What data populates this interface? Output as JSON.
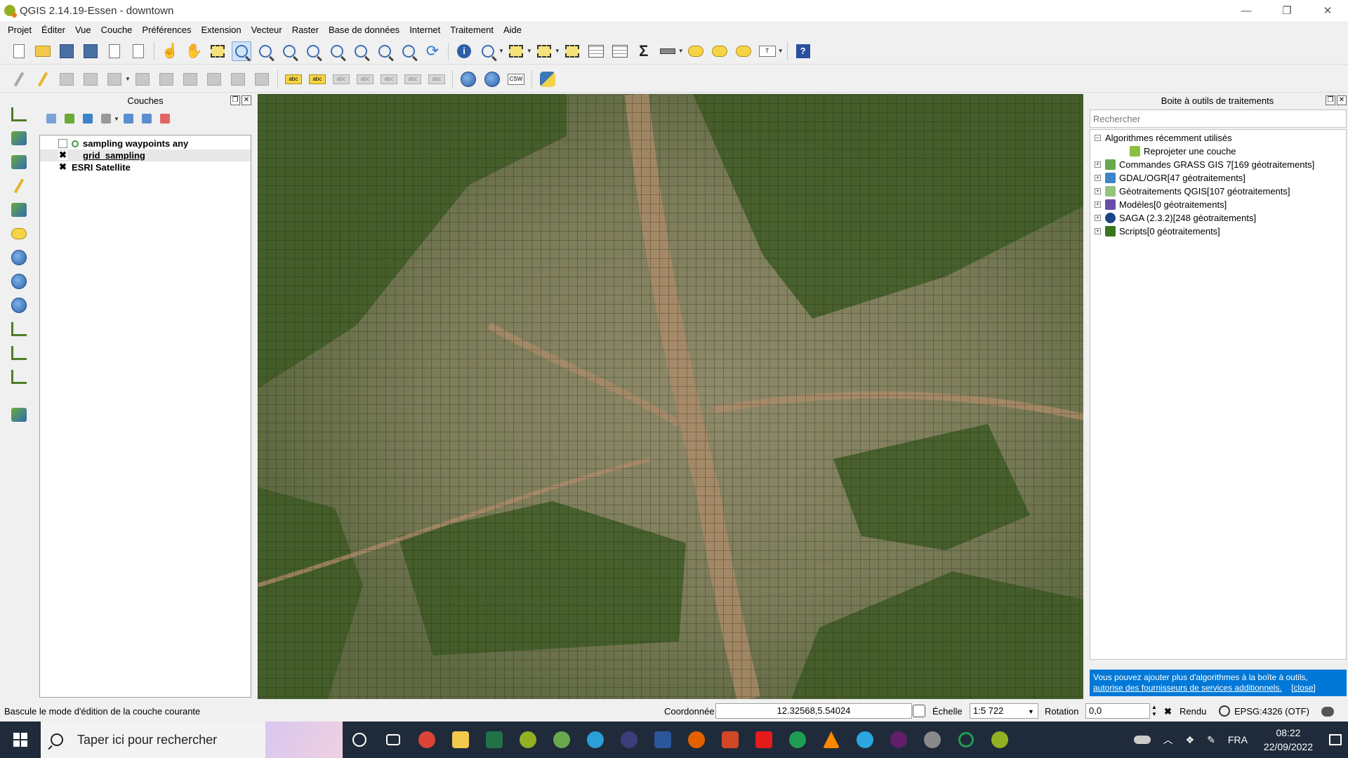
{
  "window": {
    "title": "QGIS 2.14.19-Essen - downtown",
    "minimize": "—",
    "maximize": "❐",
    "close": "✕"
  },
  "menu": [
    "Projet",
    "Éditer",
    "Vue",
    "Couche",
    "Préférences",
    "Extension",
    "Vecteur",
    "Raster",
    "Base de données",
    "Internet",
    "Traitement",
    "Aide"
  ],
  "layers_panel": {
    "title": "Couches",
    "layers": [
      {
        "name": "sampling waypoints any",
        "checked": false
      },
      {
        "name": "grid_sampling",
        "checked": true,
        "check_mark": "✖"
      },
      {
        "name": "ESRI Satellite",
        "checked": true,
        "check_mark": "✖"
      }
    ]
  },
  "toolbox": {
    "title": "Boite à outils de traitements",
    "search_placeholder": "Rechercher",
    "tree": [
      {
        "label": "Algorithmes récemment utilisés",
        "toggle": "−",
        "icon_color": ""
      },
      {
        "label": "Reprojeter une couche",
        "toggle": "",
        "icon_color": "#8bbf3f",
        "child": true
      },
      {
        "label": "Commandes GRASS GIS 7[169 géotraitements]",
        "toggle": "+",
        "icon_color": "#6aa84f"
      },
      {
        "label": "GDAL/OGR[47 géotraitements]",
        "toggle": "+",
        "icon_color": "#3d85c6"
      },
      {
        "label": "Géotraitements QGIS[107 géotraitements]",
        "toggle": "+",
        "icon_color": "#93c47d"
      },
      {
        "label": "Modèles[0 géotraitements]",
        "toggle": "+",
        "icon_color": "#674ea7"
      },
      {
        "label": "SAGA (2.3.2)[248 géotraitements]",
        "toggle": "+",
        "icon_color": "#1c4587"
      },
      {
        "label": "Scripts[0 géotraitements]",
        "toggle": "+",
        "icon_color": "#38761d"
      }
    ],
    "notice_text": "Vous pouvez ajouter plus d'algorithmes à la boîte à outils,",
    "notice_link": "autorise des fournisseurs de services additionnels.",
    "notice_close": "[close]"
  },
  "statusbar": {
    "message": "Bascule le mode d'édition de la couche courante",
    "coord_label": "Coordonnée",
    "coord_value": "12.32568,5.54024",
    "scale_label": "Échelle",
    "scale_value": "1:5 722",
    "rotation_label": "Rotation",
    "rotation_value": "0,0",
    "render_label": "Rendu",
    "render_check": "✖",
    "crs": "EPSG:4326 (OTF)"
  },
  "taskbar": {
    "search_text": "Taper ici pour rechercher",
    "apps": [
      {
        "name": "cortana",
        "color": "#ffffff"
      },
      {
        "name": "task-view",
        "color": "#ffffff"
      },
      {
        "name": "chrome",
        "color": "#db4437"
      },
      {
        "name": "file-explorer",
        "color": "#f2c94c"
      },
      {
        "name": "excel",
        "color": "#217346"
      },
      {
        "name": "qgis",
        "color": "#93b023"
      },
      {
        "name": "qgis-grass",
        "color": "#6aa84f"
      },
      {
        "name": "edge",
        "color": "#2b9fd9"
      },
      {
        "name": "eclipse",
        "color": "#3d3d7a"
      },
      {
        "name": "word",
        "color": "#2b579a"
      },
      {
        "name": "firefox",
        "color": "#e66000"
      },
      {
        "name": "powerpoint",
        "color": "#d24726"
      },
      {
        "name": "acrobat",
        "color": "#e51a1a"
      },
      {
        "name": "odk",
        "color": "#1f9d55"
      },
      {
        "name": "vlc",
        "color": "#ff8800"
      },
      {
        "name": "telegram",
        "color": "#2ca5e0"
      },
      {
        "name": "slack",
        "color": "#611f69"
      },
      {
        "name": "vpn",
        "color": "#8a8a8a"
      },
      {
        "name": "refresh-app",
        "color": "#1f9d55"
      },
      {
        "name": "qgis-3",
        "color": "#93b023"
      }
    ],
    "tray_language": "FRA",
    "time": "08:22",
    "date": "22/09/2022"
  }
}
